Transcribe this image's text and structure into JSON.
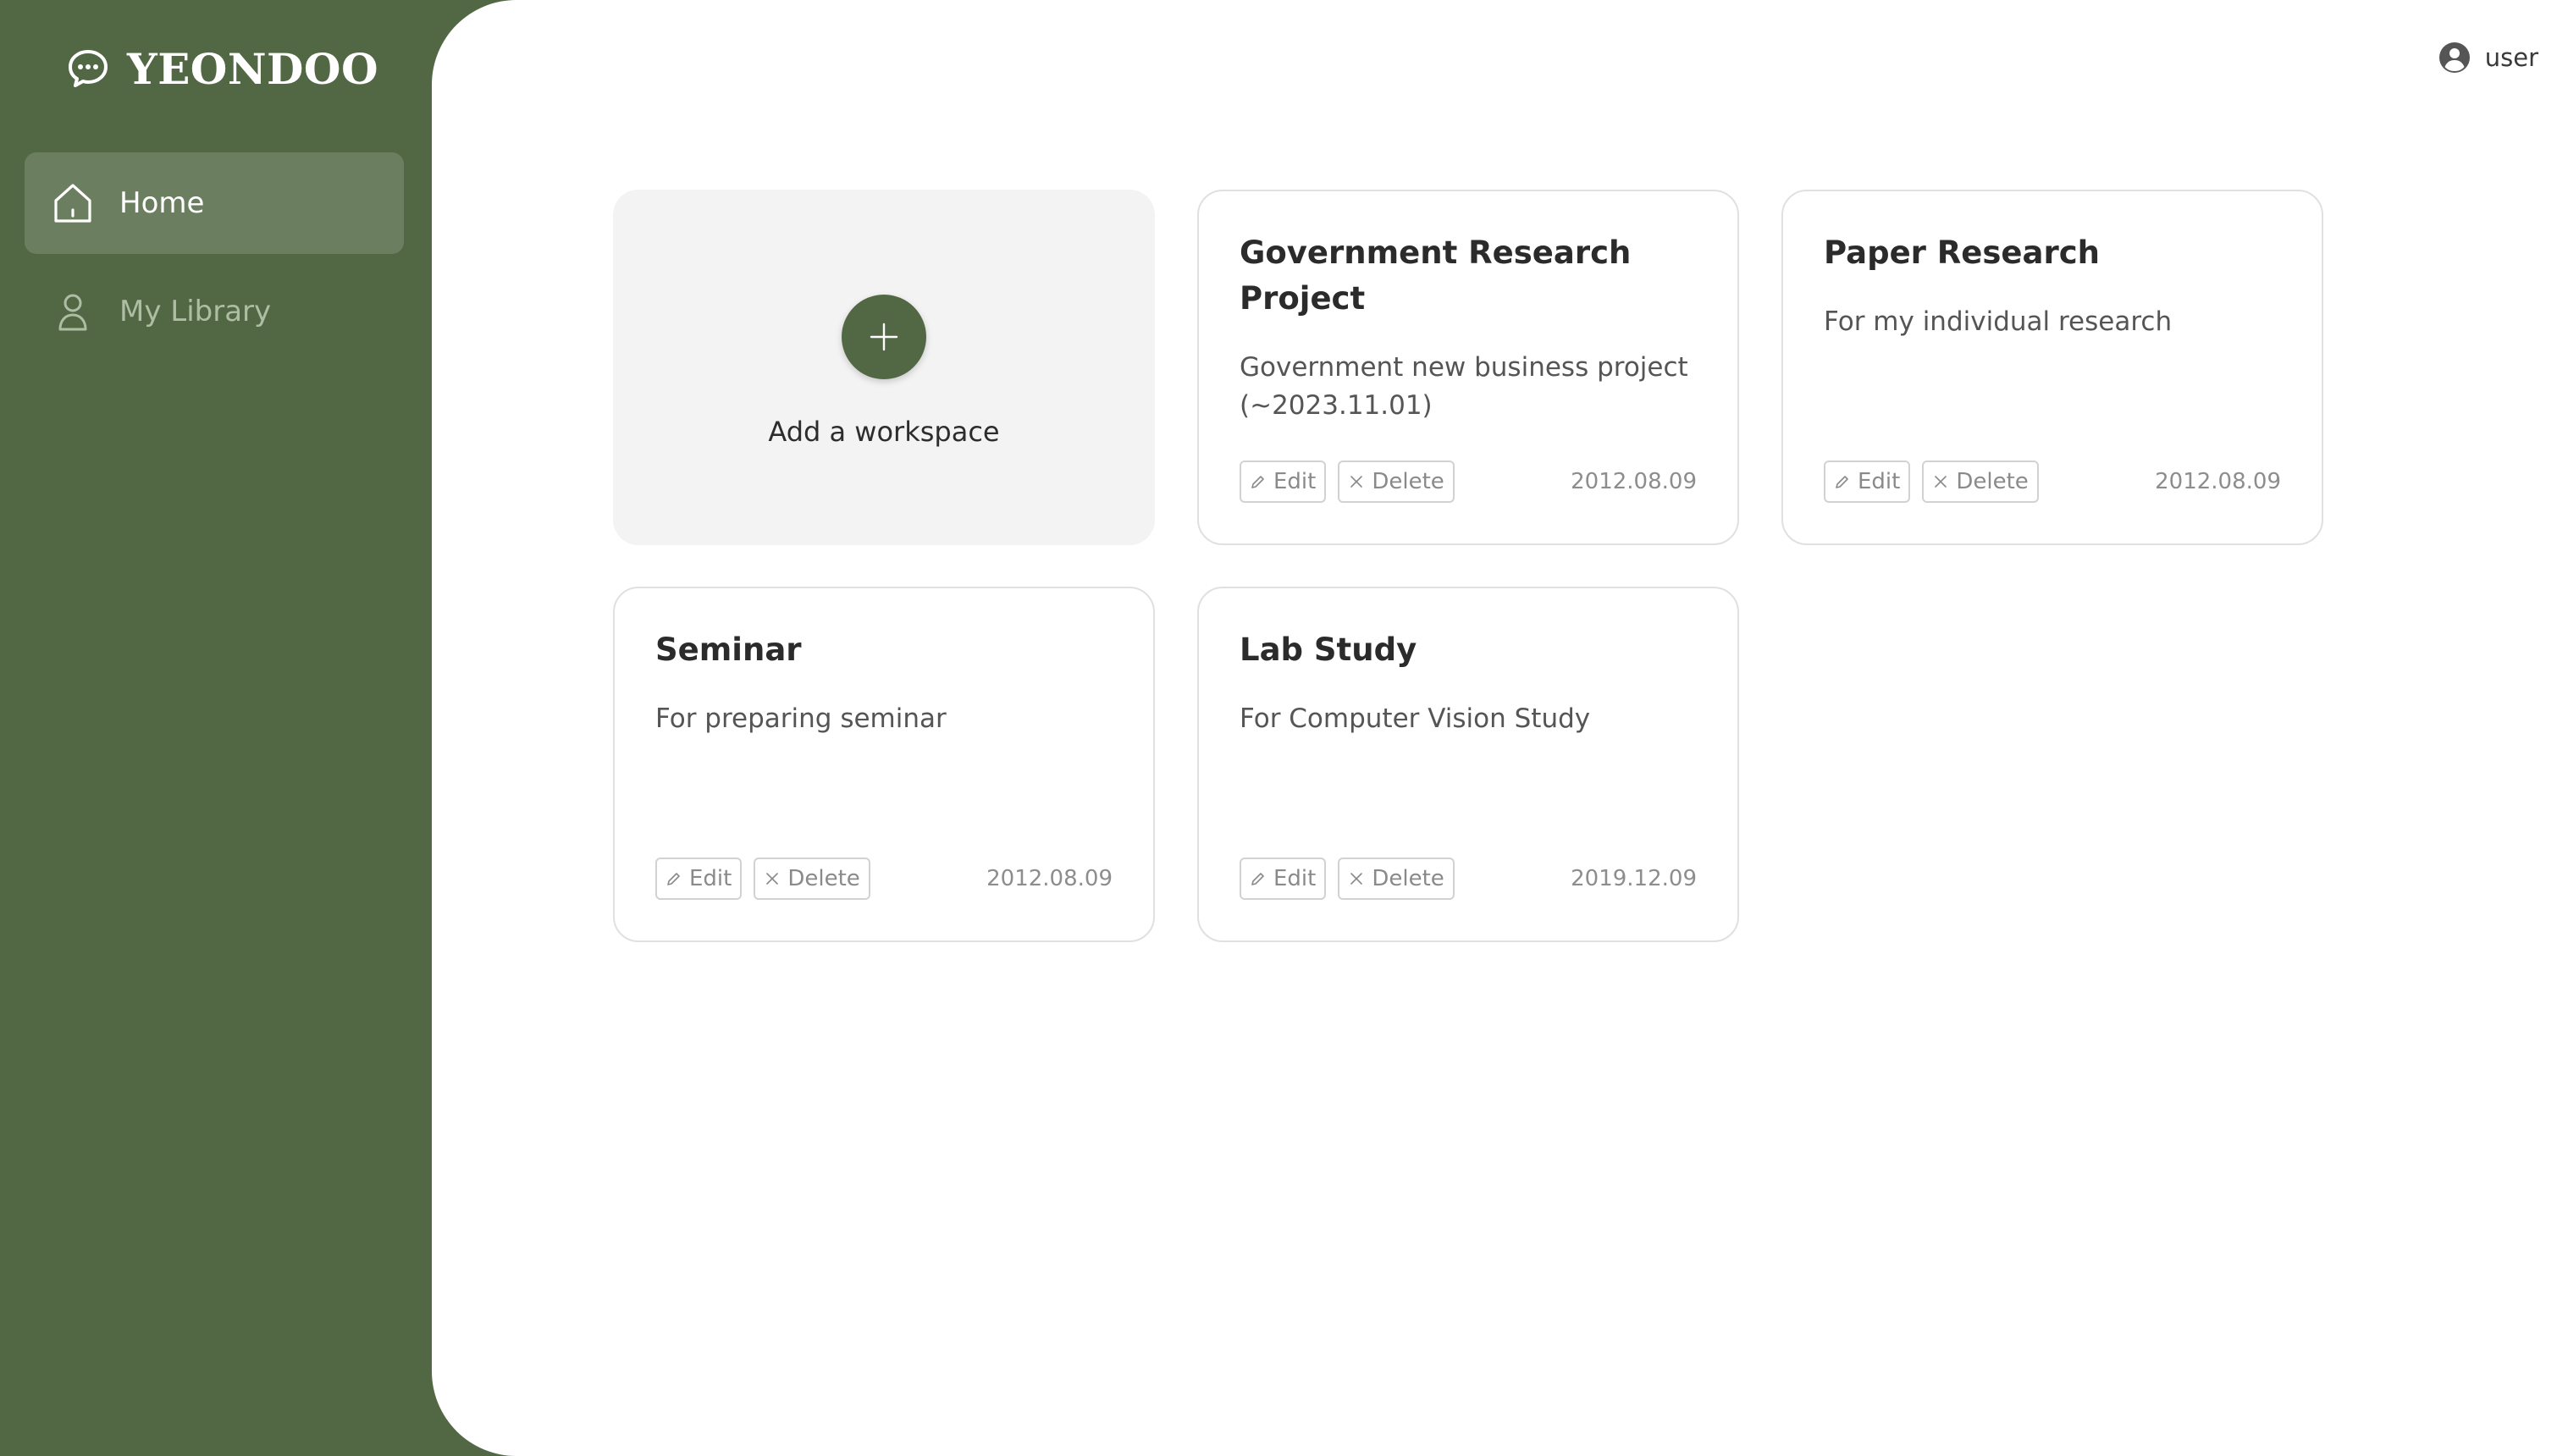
{
  "app": {
    "brand": "YEONDOO",
    "colors": {
      "sidebar": "#526845",
      "active_nav": "#6b7f60",
      "accent": "#526845"
    }
  },
  "sidebar": {
    "items": [
      {
        "label": "Home",
        "icon": "home-icon",
        "active": true
      },
      {
        "label": "My Library",
        "icon": "person-icon",
        "active": false
      }
    ]
  },
  "header": {
    "user_label": "user",
    "user_icon": "user-circle-icon"
  },
  "workspaces": {
    "add_label": "Add a workspace",
    "edit_label": "Edit",
    "delete_label": "Delete",
    "cards": [
      {
        "title": "Government Research Project",
        "description": "Government new business project (~2023.11.01)",
        "date": "2012.08.09"
      },
      {
        "title": "Paper Research",
        "description": "For my individual research",
        "date": "2012.08.09"
      },
      {
        "title": "Seminar",
        "description": "For preparing seminar",
        "date": "2012.08.09"
      },
      {
        "title": "Lab Study",
        "description": "For Computer Vision Study",
        "date": "2019.12.09"
      }
    ]
  }
}
